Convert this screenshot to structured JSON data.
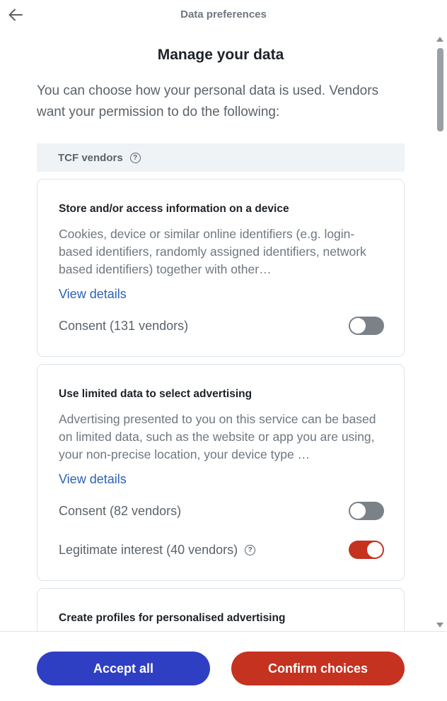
{
  "header": {
    "title": "Data preferences",
    "back_icon": "arrow-left-icon"
  },
  "main": {
    "title": "Manage your data",
    "intro": "You can choose how your personal data is used. Vendors want your permission to do the following:",
    "section": {
      "label": "TCF vendors",
      "help_icon": "?"
    }
  },
  "cards": [
    {
      "title": "Store and/or access information on a device",
      "description": "Cookies, device or similar online identifiers (e.g. login-based identifiers, randomly assigned identifiers, network based identifiers) together with other…",
      "view_details": "View details",
      "consent_label": "Consent (131 vendors)",
      "consent_on": false
    },
    {
      "title": "Use limited data to select advertising",
      "description": "Advertising presented to you on this service can be based on limited data, such as the website or app you are using, your non-precise location, your device type …",
      "view_details": "View details",
      "consent_label": "Consent (82 vendors)",
      "consent_on": false,
      "legit_label": "Legitimate interest (40 vendors)",
      "legit_help_icon": "?",
      "legit_on": true
    },
    {
      "title": "Create profiles for personalised advertising"
    }
  ],
  "footer": {
    "accept_label": "Accept all",
    "confirm_label": "Confirm choices"
  },
  "colors": {
    "accept": "#2f3fc3",
    "confirm": "#c5321f",
    "toggle_on": "#c5321f",
    "toggle_off": "#7a8188",
    "link": "#2c61b8"
  }
}
